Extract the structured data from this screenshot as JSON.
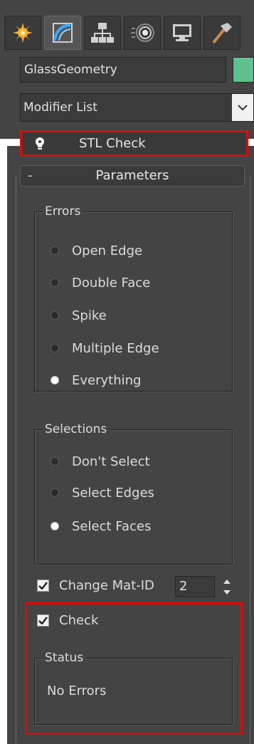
{
  "toolbar": {
    "tabs": [
      {
        "icon": "create-icon",
        "active": false
      },
      {
        "icon": "modify-icon",
        "active": true
      },
      {
        "icon": "hierarchy-icon",
        "active": false
      },
      {
        "icon": "motion-icon",
        "active": false
      },
      {
        "icon": "display-icon",
        "active": false
      },
      {
        "icon": "utilities-icon",
        "active": false
      }
    ]
  },
  "object": {
    "name": "GlassGeometry",
    "color": "#5fc08d"
  },
  "modifier_list": {
    "label": "Modifier List"
  },
  "stack": {
    "item_label": "STL Check"
  },
  "rollout": {
    "toggle": "-",
    "title": "Parameters"
  },
  "errors": {
    "title": "Errors",
    "options": [
      "Open Edge",
      "Double Face",
      "Spike",
      "Multiple Edge",
      "Everything"
    ],
    "selected": "Everything"
  },
  "selections": {
    "title": "Selections",
    "options": [
      "Don't Select",
      "Select Edges",
      "Select Faces"
    ],
    "selected": "Select Faces"
  },
  "change_mat_id": {
    "label": "Change Mat-ID",
    "checked": true,
    "value": "2"
  },
  "check": {
    "label": "Check",
    "checked": true
  },
  "status": {
    "title": "Status",
    "text": "No Errors"
  },
  "colors": {
    "panel_bg": "#444444",
    "highlight": "#d40f0f"
  }
}
